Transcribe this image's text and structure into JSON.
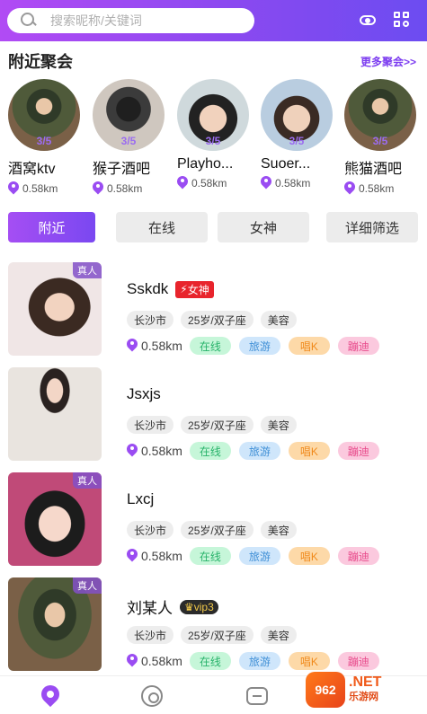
{
  "header": {
    "search_placeholder": "搜索昵称/关键词",
    "icons": [
      "search-icon",
      "eye-icon",
      "grid-icon"
    ],
    "gradient": [
      "#b14bf4",
      "#6c4cf1"
    ]
  },
  "nearby": {
    "title": "附近聚会",
    "more": "更多聚会>>",
    "items": [
      {
        "name": "酒窝ktv",
        "count": "3/5",
        "distance": "0.58km"
      },
      {
        "name": "猴子酒吧",
        "count": "3/5",
        "distance": "0.58km"
      },
      {
        "name": "Playho...",
        "count": "3/5",
        "distance": "0.58km"
      },
      {
        "name": "Suoer...",
        "count": "3/5",
        "distance": "0.58km"
      },
      {
        "name": "熊猫酒吧",
        "count": "3/5",
        "distance": "0.58km"
      }
    ]
  },
  "filters": [
    "附近",
    "在线",
    "女神",
    "详细筛选"
  ],
  "users": [
    {
      "name": "Sskdk",
      "real": "真人",
      "badge": "女神",
      "badge_type": "goddess",
      "tags": [
        "长沙市",
        "25岁/双子座",
        "美容"
      ],
      "distance": "0.58km",
      "pills": [
        "在线",
        "旅游",
        "唱K",
        "蹦迪"
      ]
    },
    {
      "name": "Jsxjs",
      "real": "",
      "badge": "",
      "badge_type": "",
      "tags": [
        "长沙市",
        "25岁/双子座",
        "美容"
      ],
      "distance": "0.58km",
      "pills": [
        "在线",
        "旅游",
        "唱K",
        "蹦迪"
      ]
    },
    {
      "name": "Lxcj",
      "real": "真人",
      "badge": "",
      "badge_type": "",
      "tags": [
        "长沙市",
        "25岁/双子座",
        "美容"
      ],
      "distance": "0.58km",
      "pills": [
        "在线",
        "旅游",
        "唱K",
        "蹦迪"
      ]
    },
    {
      "name": "刘某人",
      "real": "真人",
      "badge": "vip3",
      "badge_type": "vip",
      "tags": [
        "长沙市",
        "25岁/双子座",
        "美容"
      ],
      "distance": "0.58km",
      "pills": [
        "在线",
        "旅游",
        "唱K",
        "蹦迪"
      ]
    }
  ],
  "tabbar": {
    "icons": [
      "location-icon",
      "music-disc-icon",
      "chat-icon"
    ],
    "active": 0
  },
  "watermark": {
    "badge": "962",
    "domain": ".NET",
    "sub": "乐游网"
  }
}
